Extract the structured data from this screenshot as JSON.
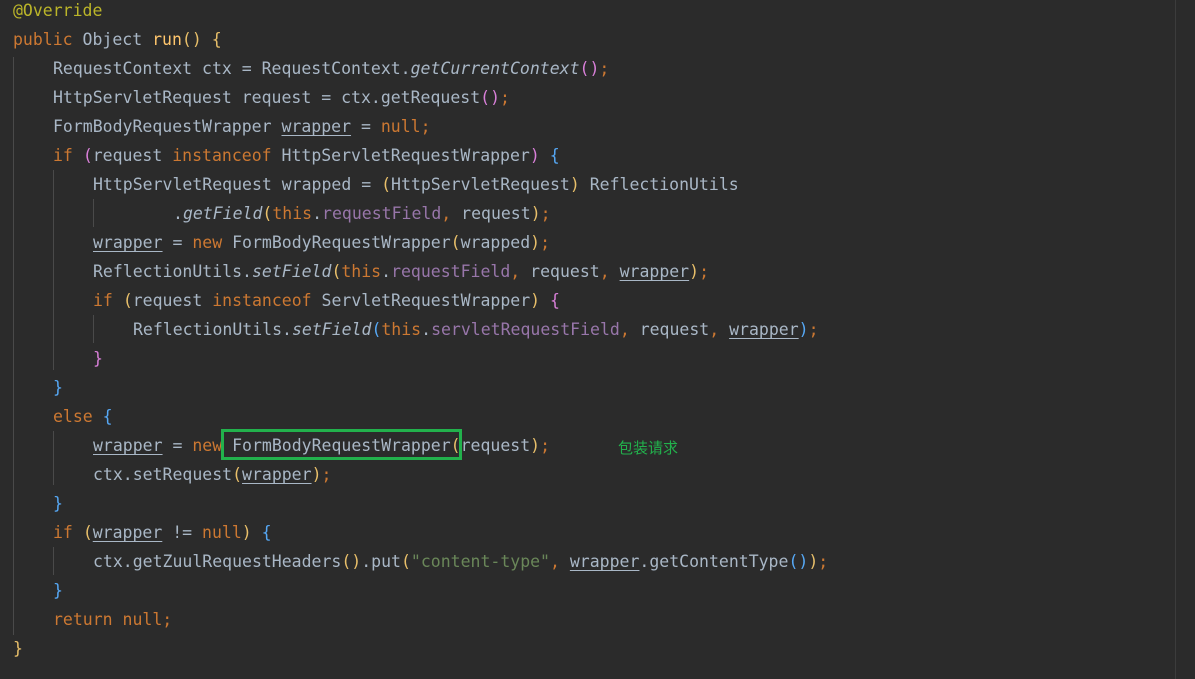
{
  "code_lines": [
    [
      {
        "t": "@Override",
        "c": "a"
      }
    ],
    [
      {
        "t": "public ",
        "c": "k"
      },
      {
        "t": "Object ",
        "c": "t"
      },
      {
        "t": "run",
        "c": "f"
      },
      {
        "t": "()",
        "c": "p1"
      },
      {
        "t": " ",
        "c": "t"
      },
      {
        "t": "{",
        "c": "p1"
      }
    ],
    [
      {
        "t": "RequestContext ctx = RequestContext.",
        "c": "t"
      },
      {
        "t": "getCurrentContext",
        "c": "i"
      },
      {
        "t": "()",
        "c": "p2"
      },
      {
        "t": ";",
        "c": "k"
      }
    ],
    [
      {
        "t": "HttpServletRequest request = ctx.getRequest",
        "c": "t"
      },
      {
        "t": "()",
        "c": "p2"
      },
      {
        "t": ";",
        "c": "k"
      }
    ],
    [
      {
        "t": "FormBodyRequestWrapper ",
        "c": "t"
      },
      {
        "t": "wrapper",
        "c": "t u"
      },
      {
        "t": " = ",
        "c": "t"
      },
      {
        "t": "null",
        "c": "k"
      },
      {
        "t": ";",
        "c": "k"
      }
    ],
    [
      {
        "t": "if ",
        "c": "k"
      },
      {
        "t": "(",
        "c": "p2"
      },
      {
        "t": "request ",
        "c": "t"
      },
      {
        "t": "instanceof ",
        "c": "k"
      },
      {
        "t": "HttpServletRequestWrapper",
        "c": "t"
      },
      {
        "t": ")",
        "c": "p2"
      },
      {
        "t": " ",
        "c": "t"
      },
      {
        "t": "{",
        "c": "p3"
      }
    ],
    [
      {
        "t": "HttpServletRequest wrapped = ",
        "c": "t"
      },
      {
        "t": "(",
        "c": "p1"
      },
      {
        "t": "HttpServletRequest",
        "c": "t"
      },
      {
        "t": ")",
        "c": "p1"
      },
      {
        "t": " ReflectionUtils",
        "c": "t"
      }
    ],
    [
      {
        "t": ".",
        "c": "t"
      },
      {
        "t": "getField",
        "c": "i"
      },
      {
        "t": "(",
        "c": "p1"
      },
      {
        "t": "this",
        "c": "k"
      },
      {
        "t": ".",
        "c": "t"
      },
      {
        "t": "requestField",
        "c": "fld"
      },
      {
        "t": ", ",
        "c": "k"
      },
      {
        "t": "request",
        "c": "t"
      },
      {
        "t": ")",
        "c": "p1"
      },
      {
        "t": ";",
        "c": "k"
      }
    ],
    [
      {
        "t": "wrapper",
        "c": "t u"
      },
      {
        "t": " = ",
        "c": "t"
      },
      {
        "t": "new ",
        "c": "k"
      },
      {
        "t": "FormBodyRequestWrapper",
        "c": "t"
      },
      {
        "t": "(",
        "c": "p1"
      },
      {
        "t": "wrapped",
        "c": "t"
      },
      {
        "t": ")",
        "c": "p1"
      },
      {
        "t": ";",
        "c": "k"
      }
    ],
    [
      {
        "t": "ReflectionUtils.",
        "c": "t"
      },
      {
        "t": "setField",
        "c": "i"
      },
      {
        "t": "(",
        "c": "p1"
      },
      {
        "t": "this",
        "c": "k"
      },
      {
        "t": ".",
        "c": "t"
      },
      {
        "t": "requestField",
        "c": "fld"
      },
      {
        "t": ", ",
        "c": "k"
      },
      {
        "t": "request",
        "c": "t"
      },
      {
        "t": ", ",
        "c": "k"
      },
      {
        "t": "wrapper",
        "c": "t u"
      },
      {
        "t": ")",
        "c": "p1"
      },
      {
        "t": ";",
        "c": "k"
      }
    ],
    [
      {
        "t": "if ",
        "c": "k"
      },
      {
        "t": "(",
        "c": "p1"
      },
      {
        "t": "request ",
        "c": "t"
      },
      {
        "t": "instanceof ",
        "c": "k"
      },
      {
        "t": "ServletRequestWrapper",
        "c": "t"
      },
      {
        "t": ")",
        "c": "p1"
      },
      {
        "t": " ",
        "c": "t"
      },
      {
        "t": "{",
        "c": "p2"
      }
    ],
    [
      {
        "t": "ReflectionUtils.",
        "c": "t"
      },
      {
        "t": "setField",
        "c": "i"
      },
      {
        "t": "(",
        "c": "p3"
      },
      {
        "t": "this",
        "c": "k"
      },
      {
        "t": ".",
        "c": "t"
      },
      {
        "t": "servletRequestField",
        "c": "fld"
      },
      {
        "t": ", ",
        "c": "k"
      },
      {
        "t": "request",
        "c": "t"
      },
      {
        "t": ", ",
        "c": "k"
      },
      {
        "t": "wrapper",
        "c": "t u"
      },
      {
        "t": ")",
        "c": "p3"
      },
      {
        "t": ";",
        "c": "k"
      }
    ],
    [
      {
        "t": "}",
        "c": "p2"
      }
    ],
    [
      {
        "t": "}",
        "c": "p3"
      }
    ],
    [
      {
        "t": "else ",
        "c": "k"
      },
      {
        "t": "{",
        "c": "p3"
      }
    ],
    [
      {
        "t": "wrapper",
        "c": "t u"
      },
      {
        "t": " = ",
        "c": "t"
      },
      {
        "t": "new ",
        "c": "k"
      },
      {
        "t": "FormBodyRequestWrapper",
        "c": "t"
      },
      {
        "t": "(",
        "c": "p1"
      },
      {
        "t": "request",
        "c": "t"
      },
      {
        "t": ")",
        "c": "p1"
      },
      {
        "t": ";",
        "c": "k"
      }
    ],
    [
      {
        "t": "ctx.setRequest",
        "c": "t"
      },
      {
        "t": "(",
        "c": "p1"
      },
      {
        "t": "wrapper",
        "c": "t u"
      },
      {
        "t": ")",
        "c": "p1"
      },
      {
        "t": ";",
        "c": "k"
      }
    ],
    [
      {
        "t": "}",
        "c": "p3"
      }
    ],
    [
      {
        "t": "if ",
        "c": "k"
      },
      {
        "t": "(",
        "c": "p1"
      },
      {
        "t": "wrapper",
        "c": "t u"
      },
      {
        "t": " != ",
        "c": "t"
      },
      {
        "t": "null",
        "c": "k"
      },
      {
        "t": ")",
        "c": "p1"
      },
      {
        "t": " ",
        "c": "t"
      },
      {
        "t": "{",
        "c": "p3"
      }
    ],
    [
      {
        "t": "ctx.getZuulRequestHeaders",
        "c": "t"
      },
      {
        "t": "()",
        "c": "p1"
      },
      {
        "t": ".put",
        "c": "t"
      },
      {
        "t": "(",
        "c": "p1"
      },
      {
        "t": "\"content-type\"",
        "c": "s"
      },
      {
        "t": ", ",
        "c": "k"
      },
      {
        "t": "wrapper",
        "c": "t u"
      },
      {
        "t": ".getContentType",
        "c": "t"
      },
      {
        "t": "()",
        "c": "p3"
      },
      {
        "t": ")",
        "c": "p1"
      },
      {
        "t": ";",
        "c": "k"
      }
    ],
    [
      {
        "t": "}",
        "c": "p3"
      }
    ],
    [
      {
        "t": "return ",
        "c": "k"
      },
      {
        "t": "null",
        "c": "k"
      },
      {
        "t": ";",
        "c": "k"
      }
    ],
    [
      {
        "t": "}",
        "c": "p1"
      }
    ]
  ],
  "annotation_note": "包装请求",
  "colors": {
    "background": "#2b2b2b",
    "highlight_box": "#22b14c",
    "note_text": "#22b14c"
  }
}
